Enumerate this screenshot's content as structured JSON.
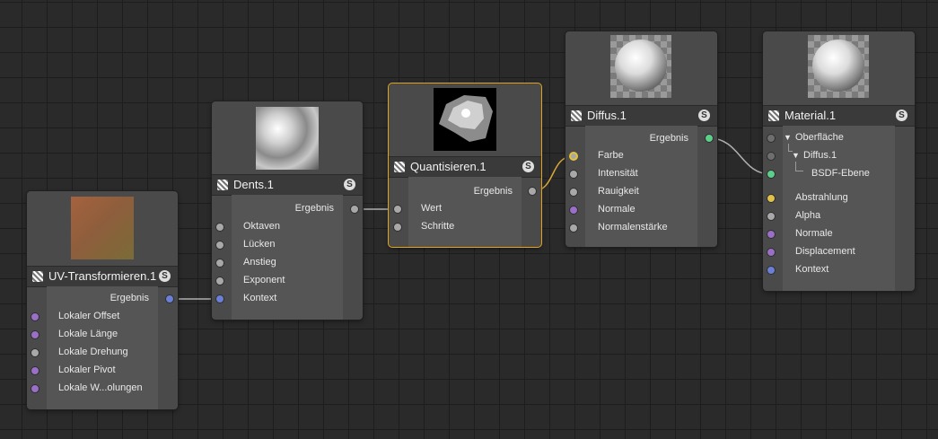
{
  "colors": {
    "background": "#2a2a2a",
    "node": "#4a4a4a",
    "selected_outline": "#e0a420",
    "port_gray": "#a8a8a8",
    "port_purple": "#9a6fc7",
    "port_blue": "#6b7fd6",
    "port_green": "#5ccf8a",
    "port_yellow": "#e0c248",
    "wire": "#b0b0b0"
  },
  "header_icon": "checker-icon",
  "badge_label": "S",
  "nodes": {
    "uv": {
      "title": "UV-Transformieren.1",
      "output": "Ergebnis",
      "inputs": [
        "Lokaler Offset",
        "Lokale Länge",
        "Lokale Drehung",
        "Lokaler Pivot",
        "Lokale W...olungen"
      ]
    },
    "dents": {
      "title": "Dents.1",
      "output": "Ergebnis",
      "inputs": [
        "Oktaven",
        "Lücken",
        "Anstieg",
        "Exponent",
        "Kontext"
      ]
    },
    "quant": {
      "title": "Quantisieren.1",
      "selected": true,
      "output": "Ergebnis",
      "inputs": [
        "Wert",
        "Schritte"
      ]
    },
    "diffus": {
      "title": "Diffus.1",
      "output": "Ergebnis",
      "inputs": [
        "Farbe",
        "Intensität",
        "Rauigkeit",
        "Normale",
        "Normalenstärke"
      ]
    },
    "material": {
      "title": "Material.1",
      "tree": {
        "oberflaeche": "Oberfläche",
        "diffus": "Diffus.1",
        "bsdf": "BSDF-Ebene"
      },
      "inputs": [
        "Abstrahlung",
        "Alpha",
        "Normale",
        "Displacement",
        "Kontext"
      ]
    }
  },
  "connections": [
    {
      "from": "UV-Transformieren.1 / Ergebnis",
      "to": "Dents.1 / Kontext"
    },
    {
      "from": "Dents.1 / Ergebnis",
      "to": "Quantisieren.1 / Wert"
    },
    {
      "from": "Quantisieren.1 / Ergebnis",
      "to": "Diffus.1 / Farbe"
    },
    {
      "from": "Diffus.1 / Ergebnis",
      "to": "Material.1 / BSDF-Ebene"
    }
  ]
}
